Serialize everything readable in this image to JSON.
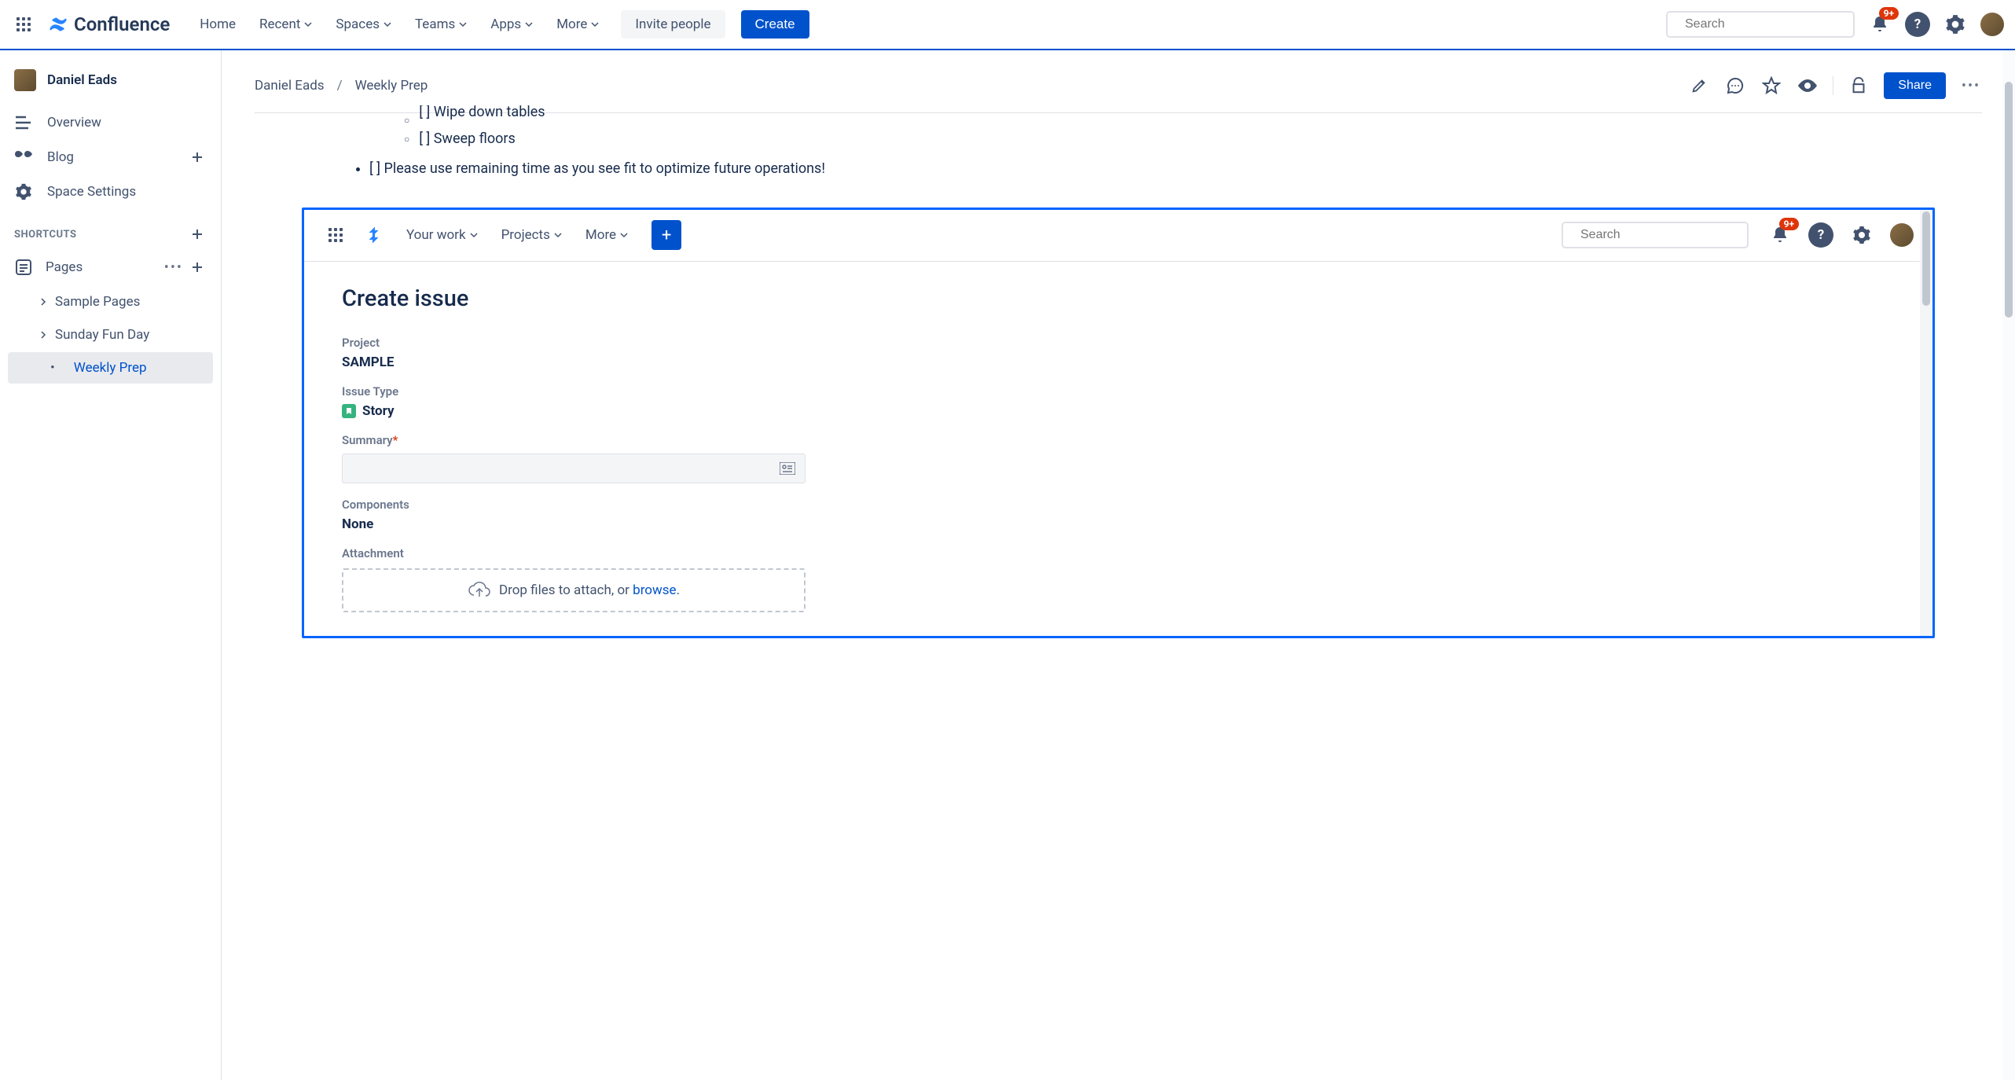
{
  "topnav": {
    "product": "Confluence",
    "items": [
      "Home",
      "Recent",
      "Spaces",
      "Teams",
      "Apps",
      "More"
    ],
    "invite": "Invite people",
    "create": "Create",
    "search_placeholder": "Search",
    "notification_badge": "9+"
  },
  "sidebar": {
    "space_name": "Daniel Eads",
    "overview": "Overview",
    "blog": "Blog",
    "settings": "Space Settings",
    "shortcuts_header": "SHORTCUTS",
    "pages_header": "Pages",
    "tree": [
      {
        "label": "Sample Pages",
        "expandable": true
      },
      {
        "label": "Sunday Fun Day",
        "expandable": true
      },
      {
        "label": "Weekly Prep",
        "expandable": false,
        "active": true
      }
    ]
  },
  "breadcrumbs": {
    "space": "Daniel Eads",
    "page": "Weekly Prep"
  },
  "page_actions": {
    "share": "Share"
  },
  "content": {
    "tasks": {
      "wipedown_partial": "Wipe down tables",
      "sweep": "[ ] Sweep floors",
      "remaining": "[ ] Please use remaining time as you see fit to optimize future operations!"
    }
  },
  "jira": {
    "nav": {
      "your_work": "Your work",
      "projects": "Projects",
      "more": "More",
      "search_placeholder": "Search",
      "badge": "9+"
    },
    "title": "Create issue",
    "project_label": "Project",
    "project_value": "SAMPLE",
    "issuetype_label": "Issue Type",
    "issuetype_value": "Story",
    "summary_label": "Summary",
    "components_label": "Components",
    "components_value": "None",
    "attachment_label": "Attachment",
    "drop_text": "Drop files to attach, or ",
    "browse": "browse"
  }
}
